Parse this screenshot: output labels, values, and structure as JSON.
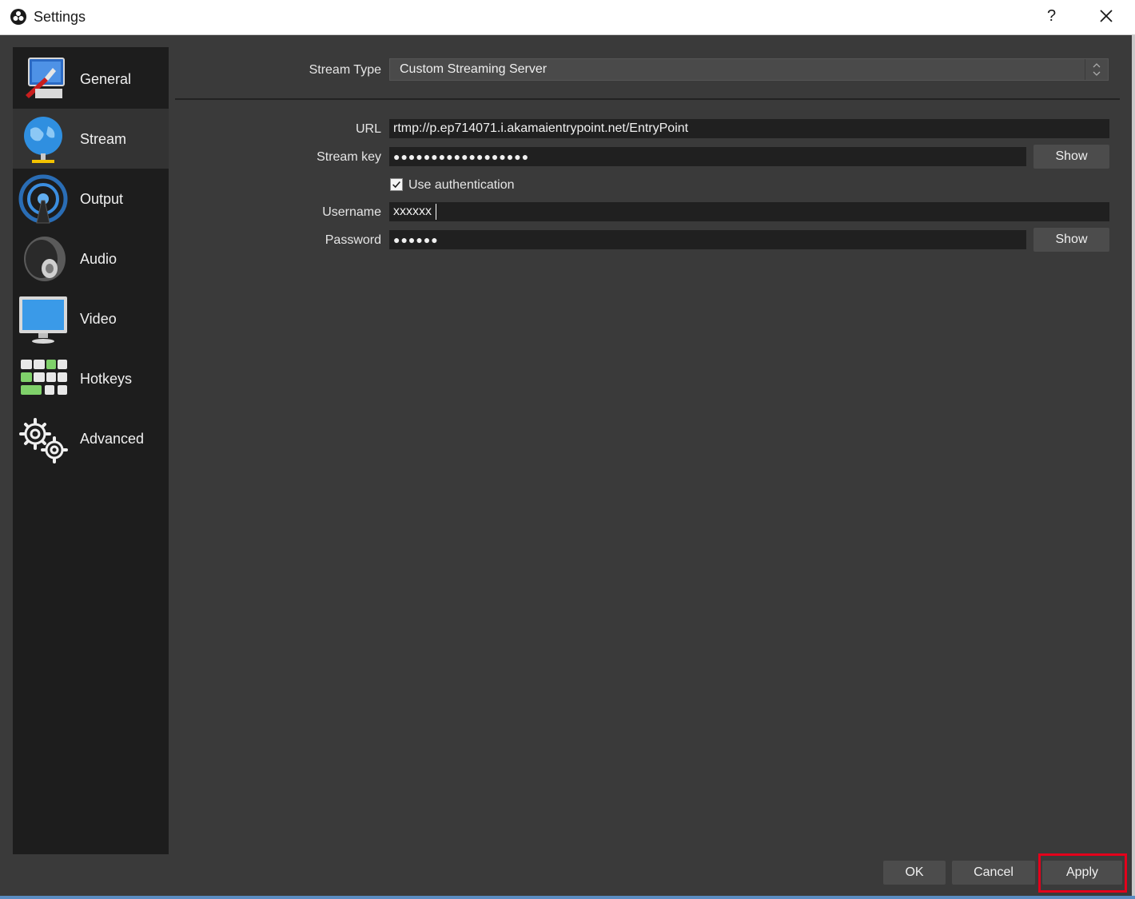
{
  "window": {
    "title": "Settings",
    "help_label": "?"
  },
  "sidebar": {
    "items": [
      {
        "label": "General",
        "icon": "general-icon"
      },
      {
        "label": "Stream",
        "icon": "stream-globe-icon",
        "active": true
      },
      {
        "label": "Output",
        "icon": "output-broadcast-icon"
      },
      {
        "label": "Audio",
        "icon": "audio-speaker-icon"
      },
      {
        "label": "Video",
        "icon": "video-monitor-icon"
      },
      {
        "label": "Hotkeys",
        "icon": "hotkeys-keyboard-icon"
      },
      {
        "label": "Advanced",
        "icon": "advanced-gears-icon"
      }
    ]
  },
  "stream": {
    "stream_type_label": "Stream Type",
    "stream_type_value": "Custom Streaming Server",
    "url_label": "URL",
    "url_value": "rtmp://p.ep714071.i.akamaientrypoint.net/EntryPoint",
    "stream_key_label": "Stream key",
    "stream_key_value": "●●●●●●●●●●●●●●●●●●",
    "show_key_label": "Show",
    "use_auth_label": "Use authentication",
    "use_auth_checked": true,
    "username_label": "Username",
    "username_value": "xxxxxx",
    "password_label": "Password",
    "password_value": "●●●●●●",
    "show_password_label": "Show"
  },
  "footer": {
    "ok_label": "OK",
    "cancel_label": "Cancel",
    "apply_label": "Apply"
  },
  "colors": {
    "background": "#3a3a3a",
    "sidebar": "#1d1d1d",
    "highlight": "#e3001b"
  }
}
